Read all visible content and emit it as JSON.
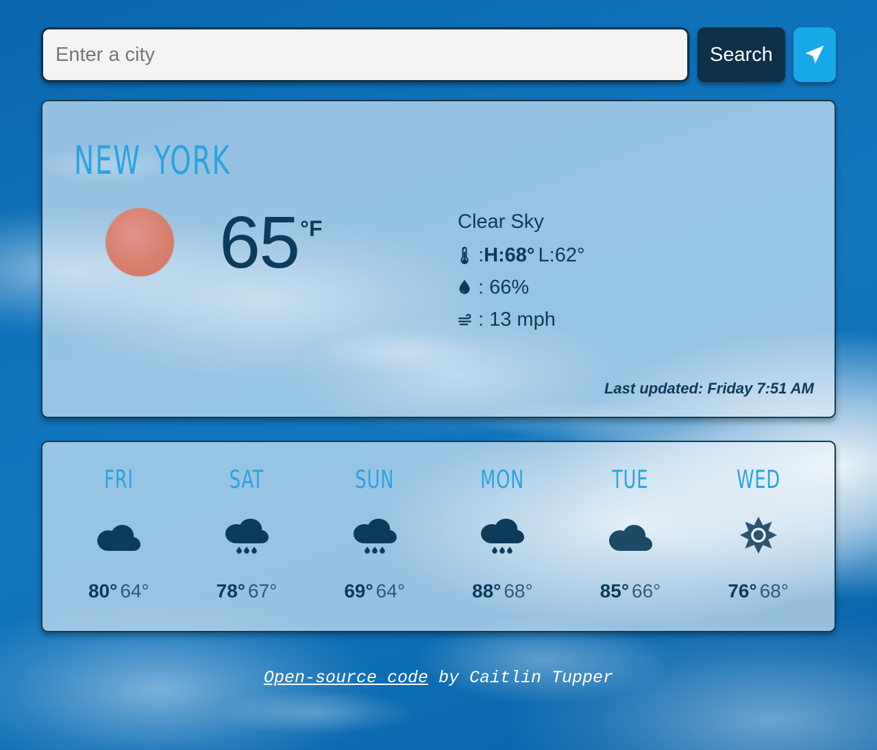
{
  "search": {
    "placeholder": "Enter a city",
    "value": "",
    "search_label": "Search",
    "geo_icon": "navigation-arrow-icon",
    "accent_color": "#17a8e8",
    "button_color": "#0e3048"
  },
  "current": {
    "city": "New York",
    "icon": "sun-disc-icon",
    "temperature": "65",
    "unit": "°F",
    "condition": "Clear Sky",
    "temp_icon": "thermometer-icon",
    "high_label": "H:68°",
    "low_label": "L:62°",
    "humidity_icon": "water-drop-icon",
    "humidity": ": 66%",
    "wind_icon": "wind-icon",
    "wind": ": 13 mph",
    "temp_separator": ": ",
    "last_updated": "Last updated: Friday 7:51 AM",
    "accent_color": "#29a4e0",
    "text_color": "#0c3b5c"
  },
  "forecast": [
    {
      "day": "Fri",
      "icon": "cloud-icon",
      "high": "80°",
      "low": "64°"
    },
    {
      "day": "Sat",
      "icon": "rain-cloud-icon",
      "high": "78°",
      "low": "67°"
    },
    {
      "day": "Sun",
      "icon": "rain-cloud-icon",
      "high": "69°",
      "low": "64°"
    },
    {
      "day": "Mon",
      "icon": "rain-cloud-icon",
      "high": "88°",
      "low": "68°"
    },
    {
      "day": "Tue",
      "icon": "cloud-icon",
      "high": "85°",
      "low": "66°"
    },
    {
      "day": "Wed",
      "icon": "sun-icon",
      "high": "76°",
      "low": "68°"
    }
  ],
  "footer": {
    "link_text": "Open-source code",
    "suffix": " by Caitlin Tupper"
  }
}
